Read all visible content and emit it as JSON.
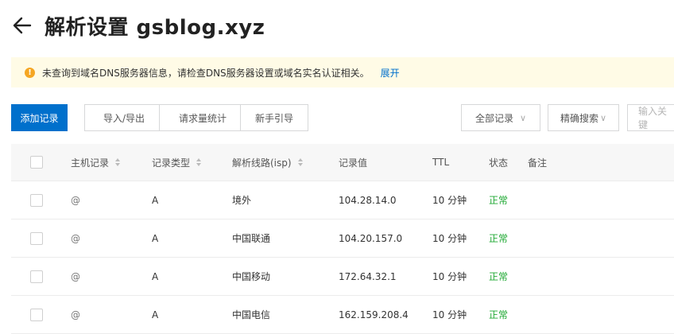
{
  "header": {
    "title": "解析设置 gsblog.xyz"
  },
  "notice": {
    "text": "未查询到域名DNS服务器信息，请检查DNS服务器设置或域名实名认证相关。",
    "link": "展开"
  },
  "toolbar": {
    "add_record": "添加记录",
    "import_export": "导入/导出",
    "request_stats": "请求量统计",
    "beginner_guide": "新手引导",
    "all_records": "全部记录",
    "precise_search": "精确搜索",
    "search_placeholder": "输入关键"
  },
  "table": {
    "columns": [
      "主机记录",
      "记录类型",
      "解析线路(isp)",
      "记录值",
      "TTL",
      "状态",
      "备注"
    ],
    "rows": [
      {
        "host": "@",
        "type": "A",
        "line": "境外",
        "value": "104.28.14.0",
        "ttl": "10 分钟",
        "status": "正常"
      },
      {
        "host": "@",
        "type": "A",
        "line": "中国联通",
        "value": "104.20.157.0",
        "ttl": "10 分钟",
        "status": "正常"
      },
      {
        "host": "@",
        "type": "A",
        "line": "中国移动",
        "value": "172.64.32.1",
        "ttl": "10 分钟",
        "status": "正常"
      },
      {
        "host": "@",
        "type": "A",
        "line": "中国电信",
        "value": "162.159.208.4",
        "ttl": "10 分钟",
        "status": "正常"
      }
    ]
  },
  "colors": {
    "accent": "#0070cc",
    "status_ok": "#1ea832",
    "notice_bg": "#fffbe6",
    "warning": "#f5a623"
  },
  "icons": {
    "back": "arrow-left-icon",
    "warning": "warning-icon",
    "sort": "sort-icon",
    "dropdown": "chevron-down-icon"
  }
}
